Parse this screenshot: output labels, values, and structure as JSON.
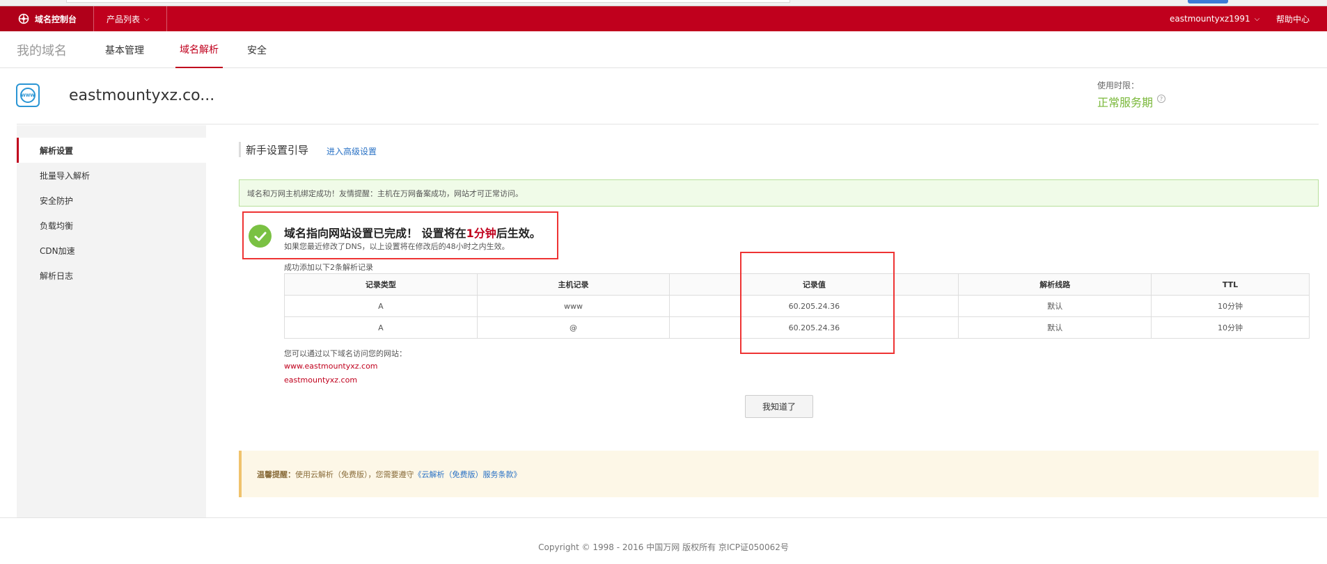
{
  "topbar": {
    "brand_label": "域名控制台",
    "products_label": "产品列表",
    "user_label": "eastmountyxz1991",
    "help_label": "帮助中心"
  },
  "subnav": {
    "title": "我的域名",
    "tabs": [
      {
        "label": "基本管理"
      },
      {
        "label": "域名解析",
        "active": true
      },
      {
        "label": "安全"
      }
    ]
  },
  "domain": {
    "icon_text": "WWW",
    "name": "eastmountyxz.co...",
    "service_label": "使用时限：",
    "service_value": "正常服务期"
  },
  "sidebar": {
    "items": [
      {
        "label": "解析设置",
        "active": true
      },
      {
        "label": "批量导入解析"
      },
      {
        "label": "安全防护"
      },
      {
        "label": "负载均衡"
      },
      {
        "label": "CDN加速"
      },
      {
        "label": "解析日志"
      }
    ]
  },
  "guide": {
    "title": "新手设置引导",
    "advanced_link": "进入高级设置"
  },
  "banner": {
    "text": "域名和万网主机绑定成功！友情提醒：主机在万网备案成功，网站才可正常访问。"
  },
  "done": {
    "title_prefix": "域名指向网站设置已完成！ 设置将在",
    "title_highlight": "1分钟",
    "title_suffix": "后生效。",
    "subtitle": "如果您最近修改了DNS，以上设置将在修改后的48小时之内生效。"
  },
  "records": {
    "added_label": "成功添加以下2条解析记录",
    "headers": [
      "记录类型",
      "主机记录",
      "记录值",
      "解析线路",
      "TTL"
    ],
    "rows": [
      [
        "A",
        "www",
        "60.205.24.36",
        "默认",
        "10分钟"
      ],
      [
        "A",
        "@",
        "60.205.24.36",
        "默认",
        "10分钟"
      ]
    ]
  },
  "visit": {
    "label": "您可以通过以下域名访问您的网站：",
    "links": [
      "www.eastmountyxz.com",
      "eastmountyxz.com"
    ]
  },
  "ok_button": "我知道了",
  "notice": {
    "title": "温馨提醒：",
    "text": "使用云解析（免费版），您需要遵守",
    "link": "《云解析（免费版）服务条款》"
  },
  "footer": {
    "text": "Copyright © 1998 - 2016 中国万网 版权所有 京ICP证050062号"
  },
  "colors": {
    "brand_red": "#c0001d",
    "success_green": "#7ac143",
    "link_blue": "#2a72c5",
    "highlight_box": "#e33333"
  }
}
